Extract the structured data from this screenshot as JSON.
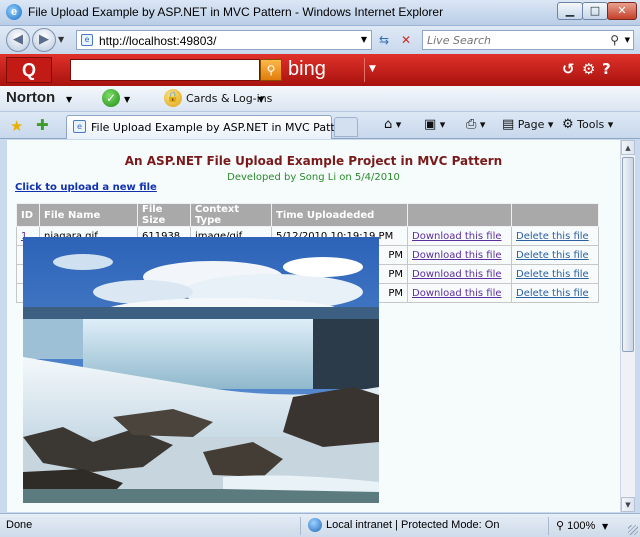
{
  "window": {
    "title": "File Upload Example by ASP.NET in MVC Pattern - Windows Internet Explorer",
    "min_glyph": "▁",
    "max_glyph": "□",
    "close_glyph": "✕"
  },
  "address_bar": {
    "url": "http://localhost:49803/",
    "search_placeholder": "Live Search"
  },
  "bing_toolbar": {
    "logo_text": "Q",
    "brand": "bing"
  },
  "norton_toolbar": {
    "brand": "Norton",
    "cards_label": "Cards & Log-ins"
  },
  "tabs": [
    {
      "label": "File Upload Example by ASP.NET in MVC Pattern"
    }
  ],
  "command_bar": {
    "page_label": "Page",
    "tools_label": "Tools"
  },
  "page": {
    "heading": "An ASP.NET File Upload Example Project in MVC Pattern",
    "subheading": "Developed by Song Li on 5/4/2010",
    "upload_link": "Click to upload a new file",
    "table": {
      "columns": [
        "ID",
        "File Name",
        "File Size",
        "Context Type",
        "Time Uploadeded",
        "",
        ""
      ],
      "rows": [
        {
          "id": "1",
          "file_name": "niagara.gif",
          "file_size": "611938",
          "context_type": "image/gif",
          "time": "5/12/2010 10:19:19 PM",
          "download": "Download this file",
          "delete": "Delete this file"
        },
        {
          "id": "",
          "file_name": "",
          "file_size": "",
          "context_type": "",
          "time": "PM",
          "download": "Download this file",
          "delete": "Delete this file"
        },
        {
          "id": "",
          "file_name": "",
          "file_size": "",
          "context_type": "",
          "time": "PM",
          "download": "Download this file",
          "delete": "Delete this file"
        },
        {
          "id": "",
          "file_name": "",
          "file_size": "",
          "context_type": "",
          "time": "PM",
          "download": "Download this file",
          "delete": "Delete this file"
        }
      ]
    }
  },
  "status_bar": {
    "status": "Done",
    "zone": "Local intranet | Protected Mode: On",
    "zoom": "100%"
  },
  "colors": {
    "heading": "#7a1a1a",
    "subheading": "#2a8b2a",
    "link": "#1030b0",
    "bing_red": "#c21b16",
    "table_header": "#a9a9a9"
  }
}
